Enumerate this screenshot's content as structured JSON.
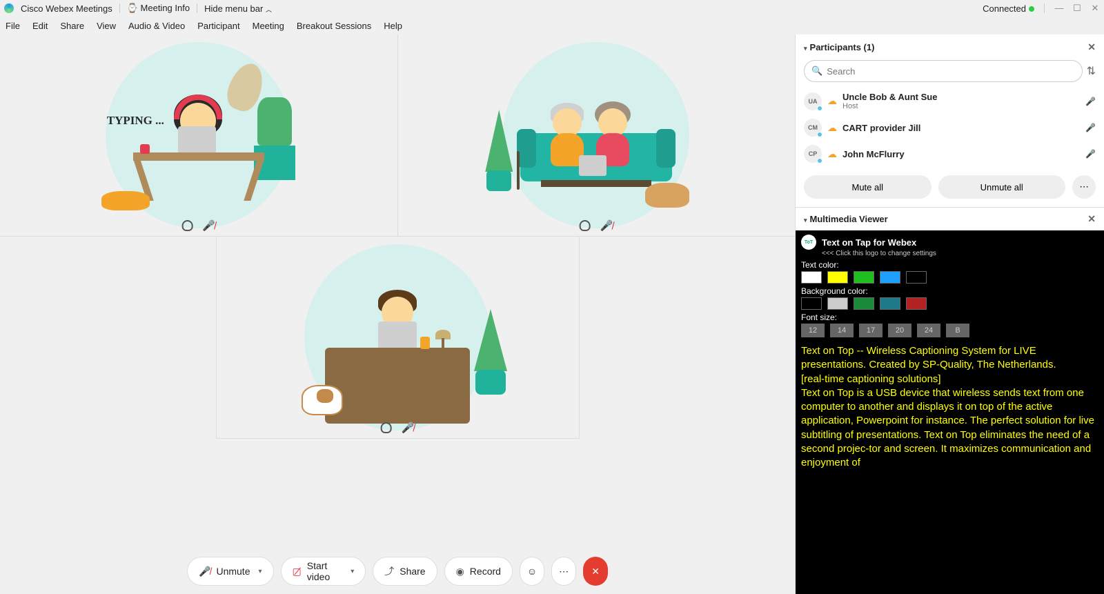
{
  "titlebar": {
    "app": "Cisco Webex Meetings",
    "info": "Meeting Info",
    "hide": "Hide menu bar",
    "connected": "Connected"
  },
  "menubar": [
    "File",
    "Edit",
    "Share",
    "View",
    "Audio & Video",
    "Participant",
    "Meeting",
    "Breakout Sessions",
    "Help"
  ],
  "tiles": {
    "typing": "TYPING ..."
  },
  "toolbar": {
    "unmute": "Unmute",
    "video": "Start video",
    "share": "Share",
    "record": "Record"
  },
  "participants": {
    "title": "Participants (1)",
    "search_ph": "Search",
    "list": [
      {
        "initials": "UA",
        "name": "Uncle Bob & Aunt Sue",
        "role": "Host"
      },
      {
        "initials": "CM",
        "name": "CART provider Jill",
        "role": ""
      },
      {
        "initials": "CP",
        "name": "John McFlurry",
        "role": ""
      }
    ],
    "mute_all": "Mute all",
    "unmute_all": "Unmute all"
  },
  "mv": {
    "title": "Multimedia Viewer",
    "tot_title": "Text on Tap  for  Webex",
    "tot_sub": "<<< Click this logo to change settings",
    "textcolor": "Text color:",
    "bgcolor": "Background color:",
    "fontsize": "Font size:",
    "text_colors": [
      "#ffffff",
      "#ffff00",
      "#1fbf1f",
      "#1fa0ff",
      "#000000"
    ],
    "bg_colors": [
      "#000000",
      "#cccccc",
      "#1a8a3a",
      "#1f7a8c",
      "#b22222"
    ],
    "font_sizes": [
      "12",
      "14",
      "17",
      "20",
      "24",
      "B"
    ],
    "caption": "Text on Top -- Wireless Captioning System for LIVE presentations. Created by SP-Quality, The Netherlands.\n[real-time captioning solutions]\nText on Top is a USB device that wireless sends text from one computer to another and displays it on top of the active application, Powerpoint for instance. The perfect solution for live subtitling of presentations. Text on Top eliminates the need of a second projec-tor and screen. It maximizes communication and enjoyment of"
  }
}
